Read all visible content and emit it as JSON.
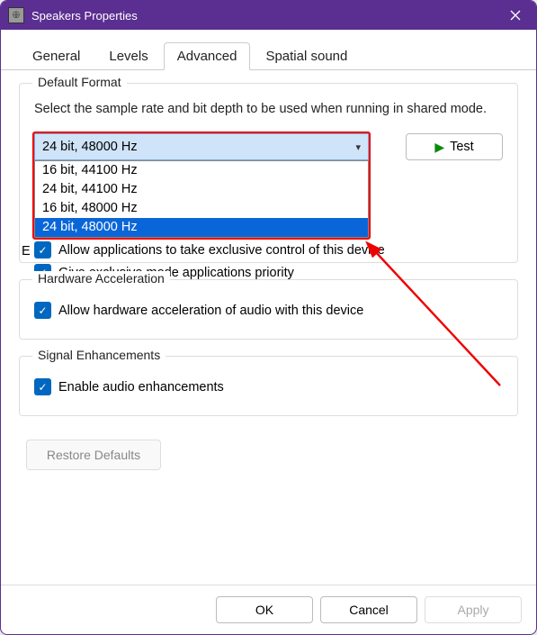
{
  "window": {
    "title": "Speakers Properties"
  },
  "tabs": [
    {
      "label": "General"
    },
    {
      "label": "Levels"
    },
    {
      "label": "Advanced"
    },
    {
      "label": "Spatial sound"
    }
  ],
  "default_format": {
    "group_title": "Default Format",
    "description": "Select the sample rate and bit depth to be used when running in shared mode.",
    "selected": "24 bit, 48000 Hz",
    "options": [
      "16 bit, 44100 Hz",
      "24 bit, 44100 Hz",
      "16 bit, 48000 Hz",
      "24 bit, 48000 Hz"
    ],
    "test_label": "Test"
  },
  "exclusive": {
    "hidden_label_prefix": "E",
    "allow_exclusive": "Allow applications to take exclusive control of this device",
    "give_priority": "Give exclusive mode applications priority"
  },
  "hw_accel": {
    "group_title": "Hardware Acceleration",
    "label": "Allow hardware acceleration of audio with this device"
  },
  "signal": {
    "group_title": "Signal Enhancements",
    "label": "Enable audio enhancements"
  },
  "restore_label": "Restore Defaults",
  "footer": {
    "ok": "OK",
    "cancel": "Cancel",
    "apply": "Apply"
  }
}
